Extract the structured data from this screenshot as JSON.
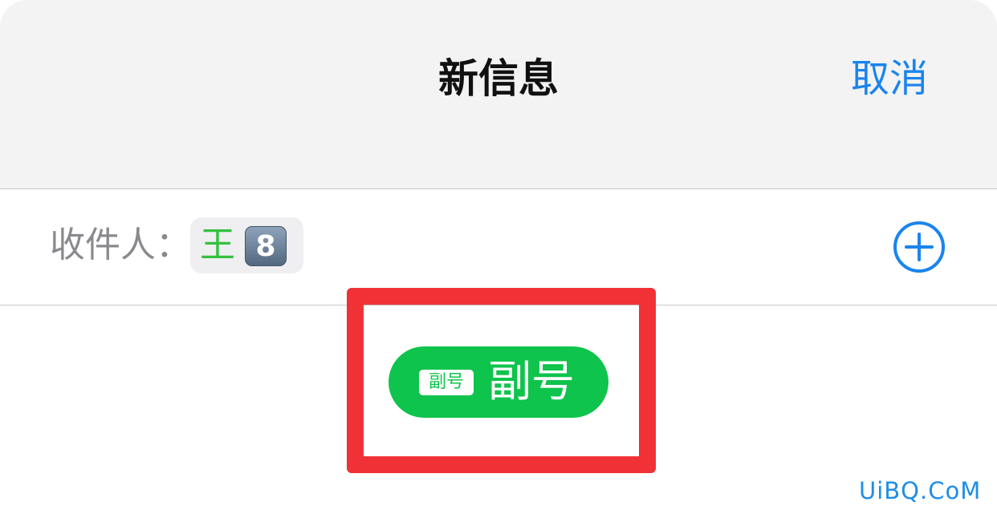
{
  "header": {
    "title": "新信息",
    "cancel_label": "取消"
  },
  "recipient": {
    "label": "收件人：",
    "contact_name": "王",
    "contact_number_badge": "8",
    "add_icon": "plus-circle-icon"
  },
  "badge": {
    "tag_text": "副号",
    "label": "副号"
  },
  "watermark": "UiBQ.CoM",
  "colors": {
    "accent_blue": "#1a84ee",
    "badge_green": "#0fc44c",
    "contact_green": "#33c13e",
    "highlight_red": "#f03237",
    "header_background": "#f3f3f4"
  }
}
